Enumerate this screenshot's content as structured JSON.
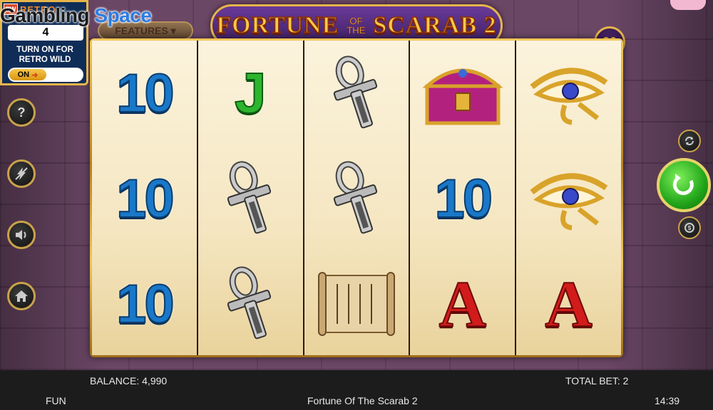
{
  "watermark": {
    "brand_a": "Gambling",
    "brand_b": "Space"
  },
  "game": {
    "title_left": "FORTUNE",
    "title_small": "OF THE",
    "title_right": "SCARAB 2",
    "features_label": "FEATURES",
    "lines": "20"
  },
  "retro": {
    "title": "RETRO",
    "count": "4",
    "message": "TURN ON FOR RETRO WILD",
    "toggle_label": "ON"
  },
  "reels": [
    [
      "10",
      "10",
      "10"
    ],
    [
      "J",
      "ankh",
      "ankh"
    ],
    [
      "ankh",
      "ankh",
      "scroll"
    ],
    [
      "chest",
      "10",
      "A"
    ],
    [
      "eye",
      "eye",
      "A"
    ]
  ],
  "side_buttons": {
    "help": "?"
  },
  "status": {
    "balance_label": "BALANCE:",
    "balance": "4,990",
    "total_bet_label": "TOTAL BET:",
    "total_bet": "2",
    "mode": "FUN",
    "game_name": "Fortune Of The Scarab 2",
    "time": "14:39"
  }
}
